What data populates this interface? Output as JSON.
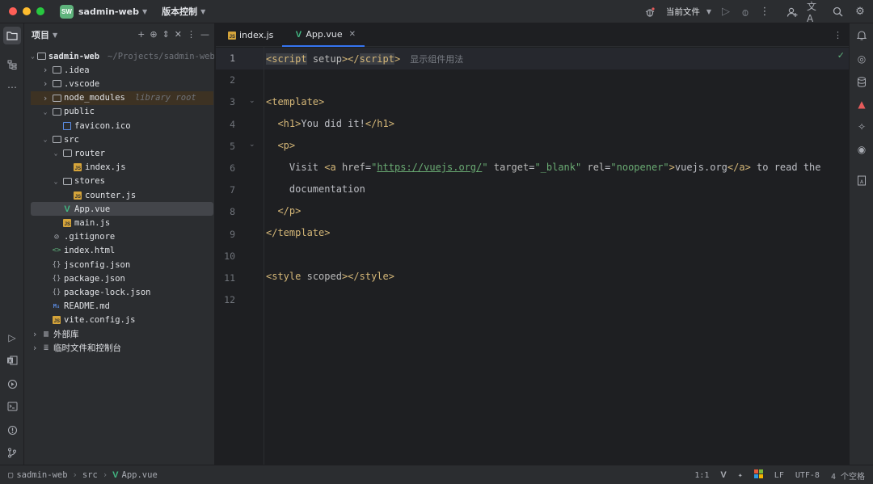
{
  "titlebar": {
    "project_badge": "SW",
    "project_name": "sadmin-web",
    "vcs_label": "版本控制",
    "run_config": "当前文件"
  },
  "project_panel": {
    "title": "项目",
    "tree": [
      {
        "label": "sadmin-web",
        "hint": "~/Projects/sadmin-web",
        "depth": 0,
        "type": "folder",
        "expanded": true
      },
      {
        "label": ".idea",
        "depth": 1,
        "type": "folder",
        "expanded": false
      },
      {
        "label": ".vscode",
        "depth": 1,
        "type": "folder",
        "expanded": false
      },
      {
        "label": "node_modules",
        "hint": "library root",
        "depth": 1,
        "type": "folder",
        "expanded": false
      },
      {
        "label": "public",
        "depth": 1,
        "type": "folder",
        "expanded": true
      },
      {
        "label": "favicon.ico",
        "depth": 2,
        "type": "image"
      },
      {
        "label": "src",
        "depth": 1,
        "type": "folder",
        "expanded": true
      },
      {
        "label": "router",
        "depth": 2,
        "type": "folder",
        "expanded": true
      },
      {
        "label": "index.js",
        "depth": 3,
        "type": "js"
      },
      {
        "label": "stores",
        "depth": 2,
        "type": "folder",
        "expanded": true
      },
      {
        "label": "counter.js",
        "depth": 3,
        "type": "js"
      },
      {
        "label": "App.vue",
        "depth": 2,
        "type": "vue",
        "selected": true
      },
      {
        "label": "main.js",
        "depth": 2,
        "type": "js"
      },
      {
        "label": ".gitignore",
        "depth": 1,
        "type": "ignore"
      },
      {
        "label": "index.html",
        "depth": 1,
        "type": "html"
      },
      {
        "label": "jsconfig.json",
        "depth": 1,
        "type": "json"
      },
      {
        "label": "package.json",
        "depth": 1,
        "type": "json"
      },
      {
        "label": "package-lock.json",
        "depth": 1,
        "type": "json"
      },
      {
        "label": "README.md",
        "depth": 1,
        "type": "md"
      },
      {
        "label": "vite.config.js",
        "depth": 1,
        "type": "js"
      },
      {
        "label": "外部库",
        "depth": 0,
        "type": "lib",
        "expanded": false
      },
      {
        "label": "临时文件和控制台",
        "depth": 0,
        "type": "scratch",
        "expanded": false
      }
    ]
  },
  "tabs": [
    {
      "label": "index.js",
      "type": "js",
      "active": false
    },
    {
      "label": "App.vue",
      "type": "vue",
      "active": true
    }
  ],
  "editor": {
    "line_numbers": [
      "1",
      "2",
      "3",
      "4",
      "5",
      "6",
      "7",
      "8",
      "9",
      "10",
      "11",
      "12"
    ],
    "inlay_hint": "显示组件用法"
  },
  "statusbar": {
    "crumbs": [
      "sadmin-web",
      "src",
      "App.vue"
    ],
    "position": "1:1",
    "line_sep": "LF",
    "encoding": "UTF-8",
    "indent": "4 个空格"
  }
}
